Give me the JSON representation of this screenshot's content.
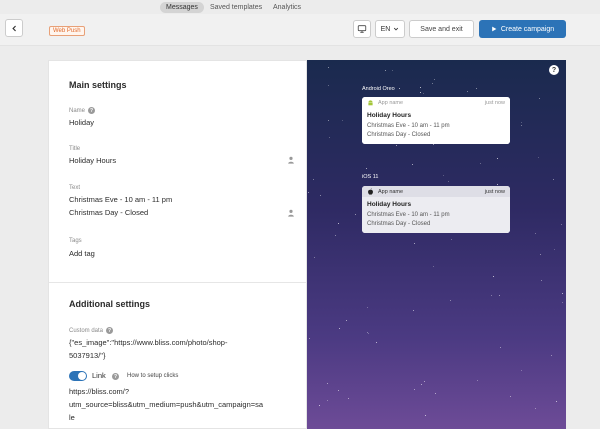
{
  "nav": {
    "tabs": [
      {
        "label": "Messages",
        "active": true
      },
      {
        "label": "Saved templates",
        "active": false
      },
      {
        "label": "Analytics",
        "active": false
      }
    ]
  },
  "toolbar": {
    "badge": "Web Push",
    "language": "EN",
    "save_label": "Save and exit",
    "create_label": "Create campaign"
  },
  "main": {
    "title": "Main settings",
    "name_label": "Name",
    "name_value": "Holiday",
    "title_label": "Title",
    "title_value": "Holiday Hours",
    "text_label": "Text",
    "text_line1": "Christmas Eve - 10 am - 11 pm",
    "text_line2": "Christmas Day - Closed",
    "tags_label": "Tags",
    "tags_value": "Add tag"
  },
  "additional": {
    "title": "Additional settings",
    "custom_label": "Custom data",
    "custom_line1": "{\"es_image\":\"https://www.bliss.com/photo/shop-",
    "custom_line2": "5037913/\"}",
    "link_label": "Link",
    "link_help": "How to setup clicks",
    "link_line1": "https://bliss.com/?",
    "link_line2": "utm_source=bliss&utm_medium=push&utm_campaign=sa",
    "link_line3": "le"
  },
  "preview": {
    "android": {
      "platform": "Android Oreo",
      "app": "App name",
      "time": "just now",
      "title": "Holiday Hours",
      "line1": "Christmas Eve - 10 am - 11 pm",
      "line2": "Christmas Day - Closed"
    },
    "ios": {
      "platform": "iOS 11",
      "app": "App name",
      "time": "just now",
      "title": "Holiday Hours",
      "line1": "Christmas Eve - 10 am - 11 pm",
      "line2": "Christmas Day - Closed"
    }
  },
  "colors": {
    "accent": "#2c73b7",
    "badge": "#e06a2c"
  }
}
